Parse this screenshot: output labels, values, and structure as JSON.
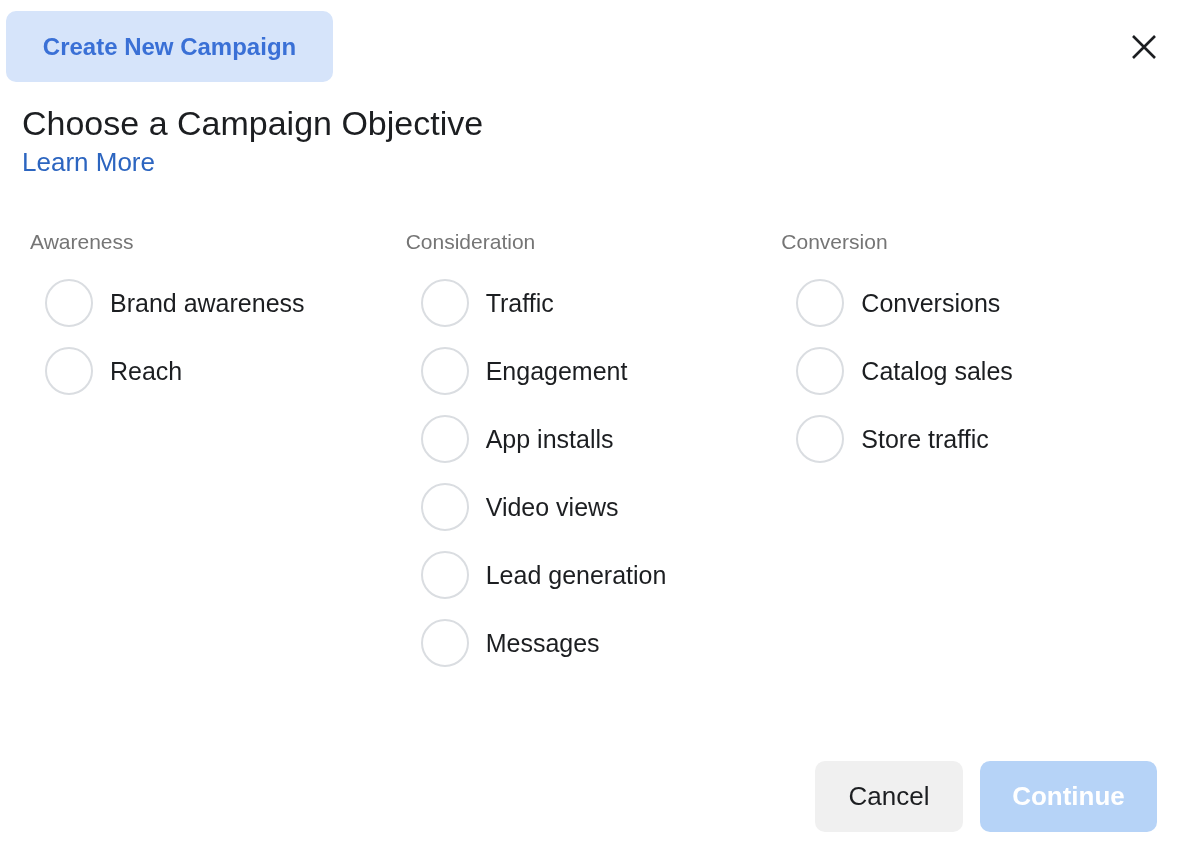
{
  "header": {
    "tab": {
      "label": "Create New Campaign",
      "selected": true
    }
  },
  "title": "Choose a Campaign Objective",
  "learn_more": "Learn More",
  "groups": [
    {
      "heading": "Awareness",
      "options": [
        {
          "label": "Brand awareness",
          "selected": false
        },
        {
          "label": "Reach",
          "selected": false
        }
      ]
    },
    {
      "heading": "Consideration",
      "options": [
        {
          "label": "Traffic",
          "selected": false
        },
        {
          "label": "Engagement",
          "selected": false
        },
        {
          "label": "App installs",
          "selected": false
        },
        {
          "label": "Video views",
          "selected": false
        },
        {
          "label": "Lead generation",
          "selected": false
        },
        {
          "label": "Messages",
          "selected": false
        }
      ]
    },
    {
      "heading": "Conversion",
      "options": [
        {
          "label": "Conversions",
          "selected": false
        },
        {
          "label": "Catalog sales",
          "selected": false
        },
        {
          "label": "Store traffic",
          "selected": false
        }
      ]
    }
  ],
  "buttons": [
    {
      "label": "Cancel",
      "kind": "secondary",
      "disabled": false
    },
    {
      "label": "Continue",
      "kind": "primary",
      "disabled": true
    }
  ]
}
